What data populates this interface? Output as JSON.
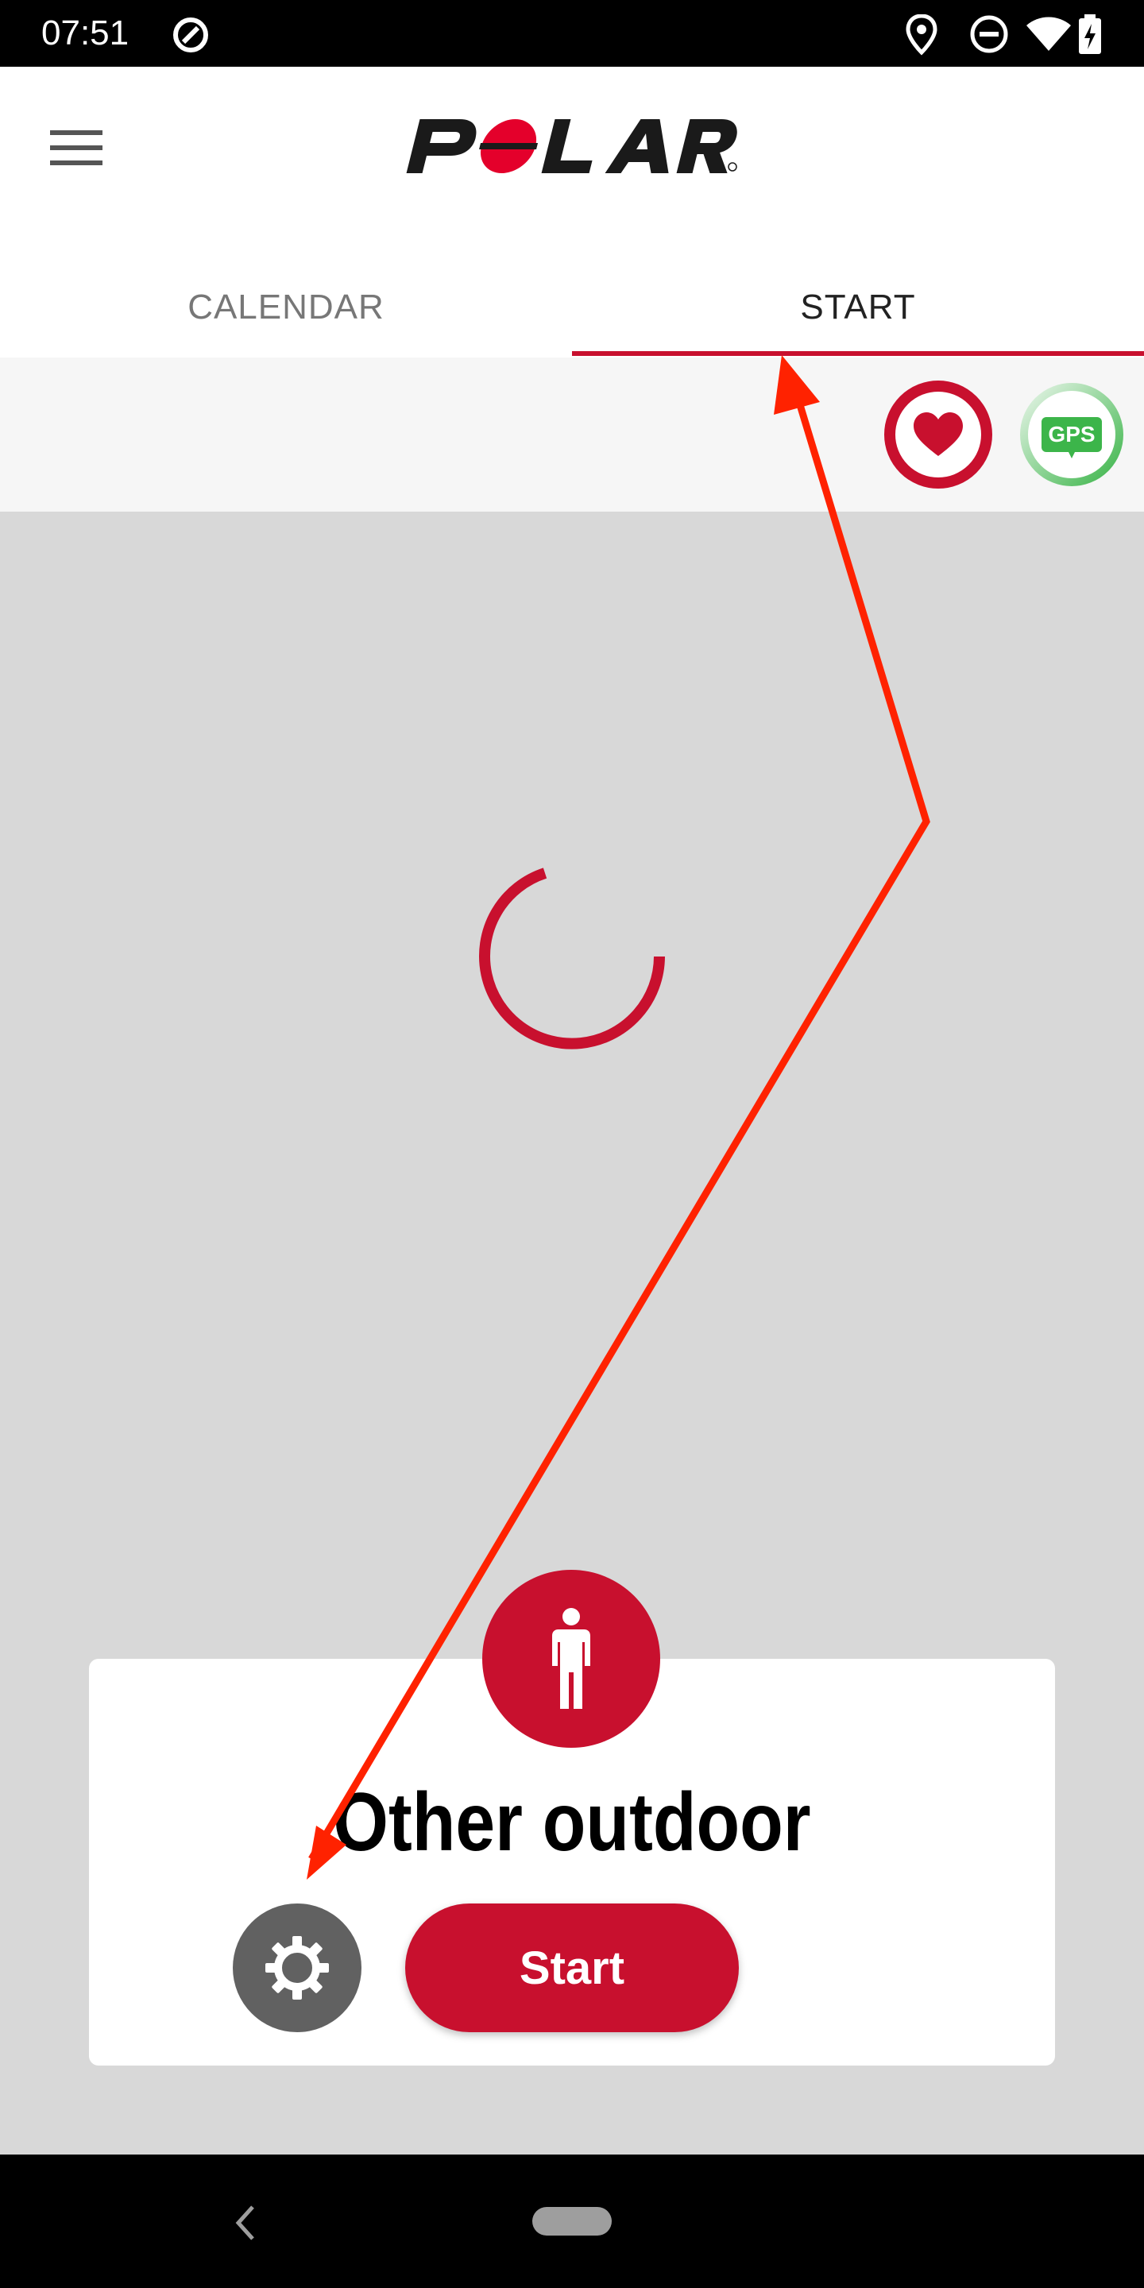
{
  "status_bar": {
    "time": "07:51",
    "icons": [
      "data-saver-icon",
      "location-icon",
      "do-not-disturb-icon",
      "wifi-icon",
      "battery-charging-icon"
    ]
  },
  "app": {
    "brand": "POLAR",
    "menu_icon": "hamburger-menu-icon"
  },
  "tabs": [
    {
      "label": "CALENDAR",
      "selected": false
    },
    {
      "label": "START",
      "selected": true
    }
  ],
  "sensors": {
    "heart_rate_icon": "heart-icon",
    "gps_label": "GPS"
  },
  "sport": {
    "name": "Other outdoor",
    "icon": "person-standing-icon",
    "settings_icon": "gear-icon",
    "start_label": "Start"
  },
  "nav": {
    "back_icon": "back-chevron-icon",
    "home_icon": "home-pill-icon"
  },
  "colors": {
    "brand_red": "#c8102e",
    "gps_green": "#3cb54a",
    "annotation_arrow": "#ff2200"
  }
}
